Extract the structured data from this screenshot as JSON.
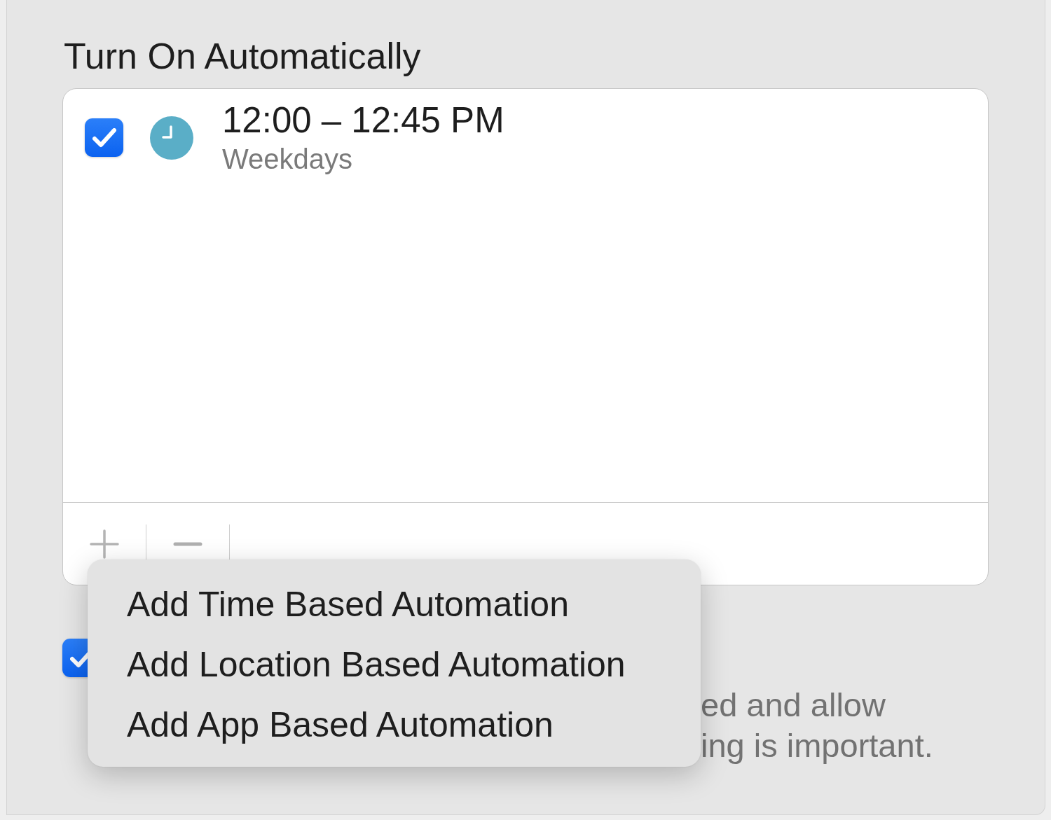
{
  "section": {
    "title": "Turn On Automatically"
  },
  "schedules": [
    {
      "checked": true,
      "time": "12:00 – 12:45 PM",
      "days": "Weekdays"
    }
  ],
  "option": {
    "checked": true,
    "description_lines": [
      "ed and allow",
      "ing is important."
    ]
  },
  "menu": {
    "items": [
      "Add Time Based Automation",
      "Add Location Based Automation",
      "Add App Based Automation"
    ]
  }
}
